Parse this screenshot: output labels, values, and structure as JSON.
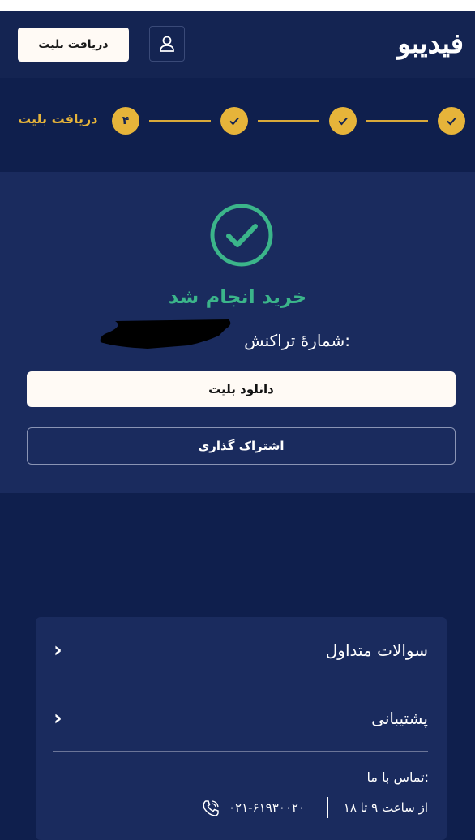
{
  "header": {
    "logo_text": "فیدیبو",
    "ticket_button": "دریافت بلیت",
    "user_icon": "user-icon"
  },
  "steps": {
    "items": [
      {
        "state": "done",
        "icon": "check-icon"
      },
      {
        "state": "done",
        "icon": "check-icon"
      },
      {
        "state": "done",
        "icon": "check-icon"
      },
      {
        "state": "current",
        "number": "۴"
      }
    ],
    "current_label": "دریافت بلیت"
  },
  "result": {
    "icon": "success-check-icon",
    "title": "خرید انجام شد",
    "transaction_label": "شمارهٔ تراکنش:",
    "download_button": "دانلود بلیت",
    "share_button": "اشتراک گذاری"
  },
  "footer": {
    "faq_label": "سوالات متداول",
    "support_label": "پشتیبانی",
    "contact_title": "تماس با ما:",
    "hours": "از ساعت ۹ تا ۱۸",
    "phone": "۰۲۱-۶۱۹۳۰۰۲۰",
    "phone_icon": "phone-icon"
  },
  "colors": {
    "background": "#0f1f4d",
    "card": "#1a2b5e",
    "accent_gold": "#e6b43a",
    "success_green": "#3bb58a"
  }
}
